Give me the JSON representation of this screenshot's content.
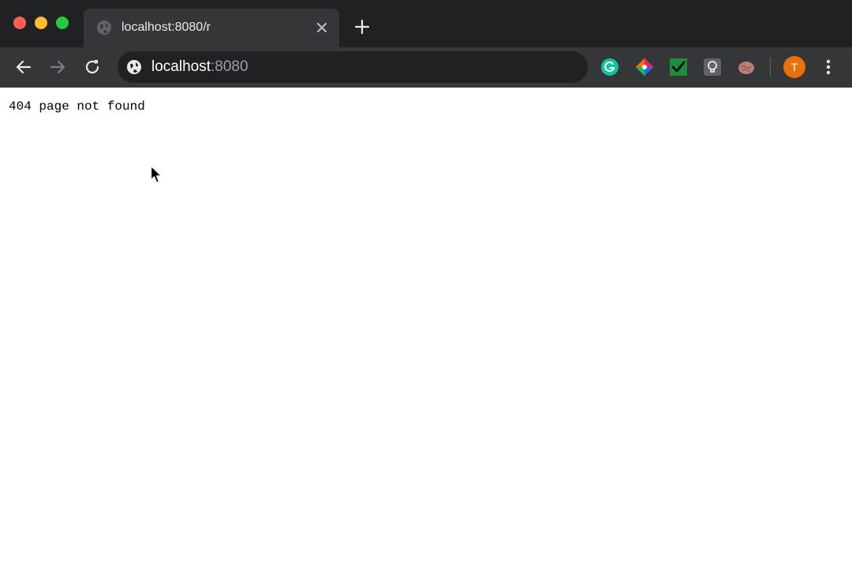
{
  "window": {
    "controls": [
      "close",
      "minimize",
      "maximize"
    ]
  },
  "tabs": [
    {
      "title": "localhost:8080/r",
      "icon": "globe-icon",
      "active": true
    }
  ],
  "toolbar": {
    "back_icon": "back-arrow-icon",
    "forward_icon": "forward-arrow-icon",
    "reload_icon": "reload-icon",
    "omnibox": {
      "icon": "globe-icon",
      "host": "localhost",
      "port": ":8080"
    },
    "extensions": [
      {
        "name": "grammarly-extension-icon",
        "color": "#15c39a"
      },
      {
        "name": "color-wheel-extension-icon",
        "color": "#e91e63"
      },
      {
        "name": "checkmark-extension-icon",
        "color": "#1e8e3e"
      },
      {
        "name": "lightbulb-extension-icon",
        "color": "#9aa0a6"
      },
      {
        "name": "brain-extension-icon",
        "color": "#c48a7a"
      }
    ],
    "profile": {
      "initial": "T",
      "color": "#e8710a"
    },
    "menu_icon": "more-vert-icon"
  },
  "page": {
    "message": "404 page not found"
  }
}
